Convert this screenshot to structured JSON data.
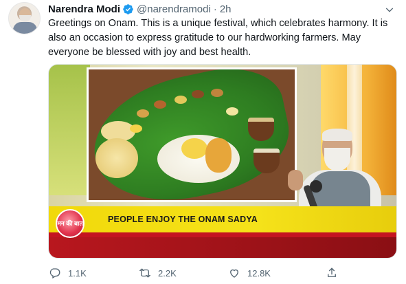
{
  "tweet": {
    "author": {
      "name": "Narendra Modi",
      "handle": "@narendramodi",
      "separator": "·",
      "time": "2h",
      "verified_icon": "verified-badge-icon"
    },
    "text": "Greetings on Onam. This is a unique festival, which celebrates harmony. It is also an occasion to express gratitude to our hardworking farmers. May everyone be blessed with joy and best health.",
    "media": {
      "badge_text": "मन की बात",
      "caption": "PEOPLE ENJOY THE ONAM SADYA"
    },
    "actions": {
      "replies": "1.1K",
      "retweets": "2.2K",
      "likes": "12.8K"
    }
  },
  "colors": {
    "accent_blue": "#1d9bf0",
    "muted_text": "#536471",
    "caption_yellow": "#f1d90a",
    "caption_red": "#c41421"
  }
}
